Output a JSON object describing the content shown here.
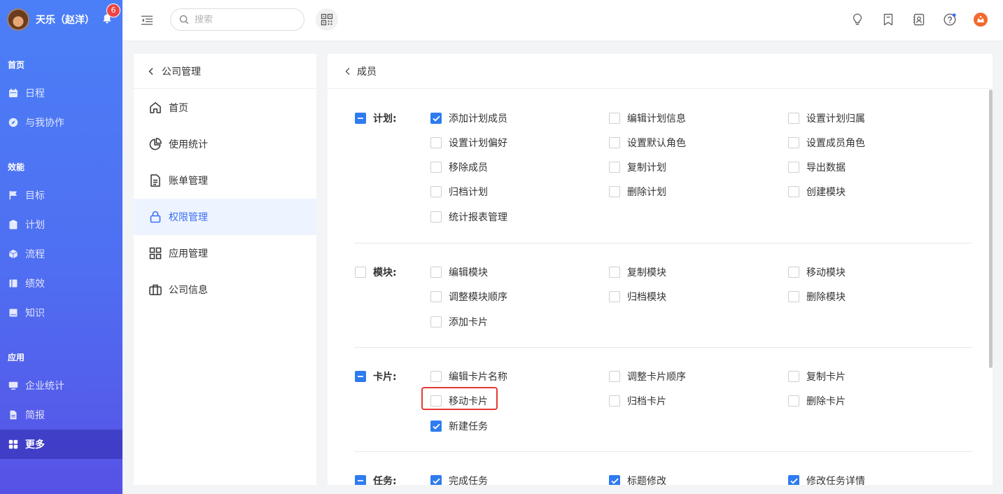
{
  "nav": {
    "user_name": "天乐（赵洋）",
    "notification_count": "6",
    "sections": [
      {
        "title": "首页",
        "items": [
          {
            "label": "日程",
            "icon": "calendar-icon"
          },
          {
            "label": "与我协作",
            "icon": "compass-icon"
          }
        ]
      },
      {
        "title": "效能",
        "items": [
          {
            "label": "目标",
            "icon": "flag-icon"
          },
          {
            "label": "计划",
            "icon": "clipboard-icon"
          },
          {
            "label": "流程",
            "icon": "cube-icon"
          },
          {
            "label": "绩效",
            "icon": "book-icon"
          },
          {
            "label": "知识",
            "icon": "notebook-icon"
          }
        ]
      },
      {
        "title": "应用",
        "items": [
          {
            "label": "企业统计",
            "icon": "monitor-icon"
          },
          {
            "label": "简报",
            "icon": "file-icon"
          },
          {
            "label": "更多",
            "icon": "grid-icon",
            "active": true
          }
        ]
      }
    ]
  },
  "topbar": {
    "search_placeholder": "搜索"
  },
  "subnav": {
    "back_label": "公司管理",
    "items": [
      {
        "label": "首页",
        "icon": "home-icon"
      },
      {
        "label": "使用统计",
        "icon": "pie-chart-icon"
      },
      {
        "label": "账单管理",
        "icon": "document-icon"
      },
      {
        "label": "权限管理",
        "icon": "lock-icon",
        "active": true
      },
      {
        "label": "应用管理",
        "icon": "apps-icon"
      },
      {
        "label": "公司信息",
        "icon": "briefcase-icon"
      }
    ]
  },
  "main": {
    "back_label": "成员",
    "groups": [
      {
        "label": "计划:",
        "state": "partial",
        "permissions": [
          {
            "label": "添加计划成员",
            "checked": true
          },
          {
            "label": "编辑计划信息",
            "checked": false
          },
          {
            "label": "设置计划归属",
            "checked": false
          },
          {
            "label": "设置计划偏好",
            "checked": false
          },
          {
            "label": "设置默认角色",
            "checked": false
          },
          {
            "label": "设置成员角色",
            "checked": false
          },
          {
            "label": "移除成员",
            "checked": false
          },
          {
            "label": "复制计划",
            "checked": false
          },
          {
            "label": "导出数据",
            "checked": false
          },
          {
            "label": "归档计划",
            "checked": false
          },
          {
            "label": "删除计划",
            "checked": false
          },
          {
            "label": "创建模块",
            "checked": false
          },
          {
            "label": "统计报表管理",
            "checked": false
          }
        ]
      },
      {
        "label": "模块:",
        "state": "unchecked",
        "permissions": [
          {
            "label": "编辑模块",
            "checked": false
          },
          {
            "label": "复制模块",
            "checked": false
          },
          {
            "label": "移动模块",
            "checked": false
          },
          {
            "label": "调整模块顺序",
            "checked": false
          },
          {
            "label": "归档模块",
            "checked": false
          },
          {
            "label": "删除模块",
            "checked": false
          },
          {
            "label": "添加卡片",
            "checked": false
          }
        ]
      },
      {
        "label": "卡片:",
        "state": "partial",
        "permissions": [
          {
            "label": "编辑卡片名称",
            "checked": false
          },
          {
            "label": "调整卡片顺序",
            "checked": false
          },
          {
            "label": "复制卡片",
            "checked": false
          },
          {
            "label": "移动卡片",
            "checked": false,
            "highlighted": true
          },
          {
            "label": "归档卡片",
            "checked": false
          },
          {
            "label": "删除卡片",
            "checked": false
          },
          {
            "label": "新建任务",
            "checked": true
          }
        ]
      },
      {
        "label": "任务:",
        "state": "partial",
        "permissions": [
          {
            "label": "完成任务",
            "checked": true
          },
          {
            "label": "标题修改",
            "checked": true
          },
          {
            "label": "修改任务详情",
            "checked": true
          }
        ]
      }
    ]
  },
  "colors": {
    "accent": "#2f7bf0",
    "nav_gradient_top": "#4b7ff7",
    "nav_gradient_bottom": "#5752e6",
    "highlight_border": "#e53935",
    "badge": "#f04343",
    "logo": "#f26a2e"
  }
}
